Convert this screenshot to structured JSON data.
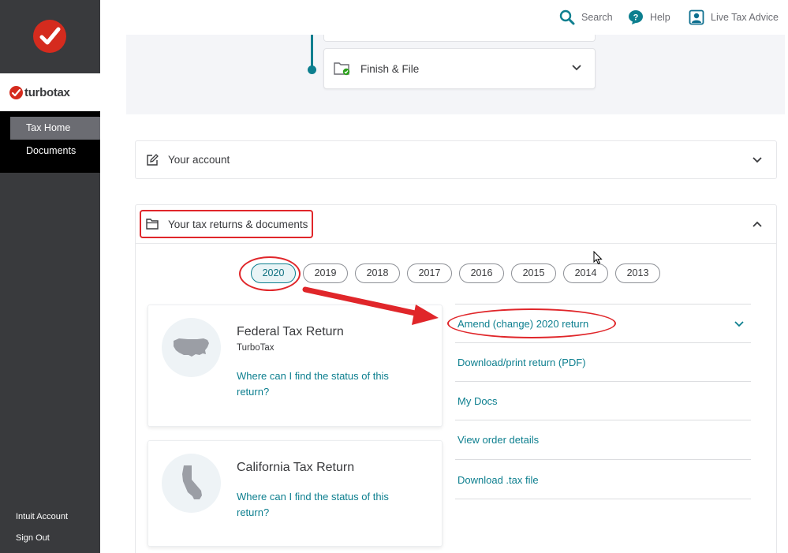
{
  "sidebar": {
    "brand": "turbotax",
    "nav": [
      {
        "label": "Tax Home",
        "active": true
      },
      {
        "label": "Documents",
        "active": false
      }
    ],
    "bottom_links": [
      "Intuit Account",
      "Sign Out"
    ]
  },
  "topbar": {
    "search_label": "Search",
    "help_label": "Help",
    "live_advice_label": "Live Tax Advice"
  },
  "progress": {
    "finish_file_label": "Finish & File"
  },
  "account_panel": {
    "title": "Your account"
  },
  "returns_panel": {
    "title": "Your tax returns & documents",
    "years": [
      "2020",
      "2019",
      "2018",
      "2017",
      "2016",
      "2015",
      "2014",
      "2013"
    ],
    "selected_year": "2020"
  },
  "returns": [
    {
      "title": "Federal Tax Return",
      "subtitle": "TurboTax",
      "status_link": "Where can I find the status of this return?",
      "icon": "usa-map-icon"
    },
    {
      "title": "California Tax Return",
      "subtitle": "",
      "status_link": "Where can I find the status of this return?",
      "icon": "california-map-icon"
    }
  ],
  "actions": [
    {
      "label": "Amend (change) 2020 return",
      "expandable": true
    },
    {
      "label": "Download/print return (PDF)",
      "expandable": false
    },
    {
      "label": "My Docs",
      "expandable": false
    },
    {
      "label": "View order details",
      "expandable": false
    },
    {
      "label": "Download .tax file",
      "expandable": false
    }
  ],
  "colors": {
    "sidebar_bg": "#393a3d",
    "brand_red": "#d52b1e",
    "link_teal": "#0d7f8f",
    "annotation_red": "#e0262a"
  }
}
